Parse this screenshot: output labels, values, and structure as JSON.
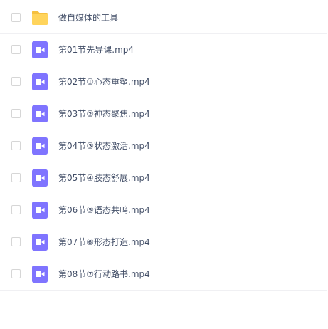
{
  "files": [
    {
      "name": "做自媒体的工具",
      "icon": "folder-icon"
    },
    {
      "name": "第01节先导课.mp4",
      "icon": "video-file-icon"
    },
    {
      "name": "第02节①心态重塑.mp4",
      "icon": "video-file-icon"
    },
    {
      "name": "第03节②神态聚焦.mp4",
      "icon": "video-file-icon"
    },
    {
      "name": "第04节③状态激活.mp4",
      "icon": "video-file-icon"
    },
    {
      "name": "第05节④肢态舒展.mp4",
      "icon": "video-file-icon"
    },
    {
      "name": "第06节⑤语态共鸣.mp4",
      "icon": "video-file-icon"
    },
    {
      "name": "第07节⑥形态打造.mp4",
      "icon": "video-file-icon"
    },
    {
      "name": "第08节⑦行动路书.mp4",
      "icon": "video-file-icon"
    }
  ],
  "colors": {
    "folder": "#ffd45c",
    "folder_tab": "#f5c040",
    "video": "#7f74ff",
    "text": "#424e67"
  }
}
